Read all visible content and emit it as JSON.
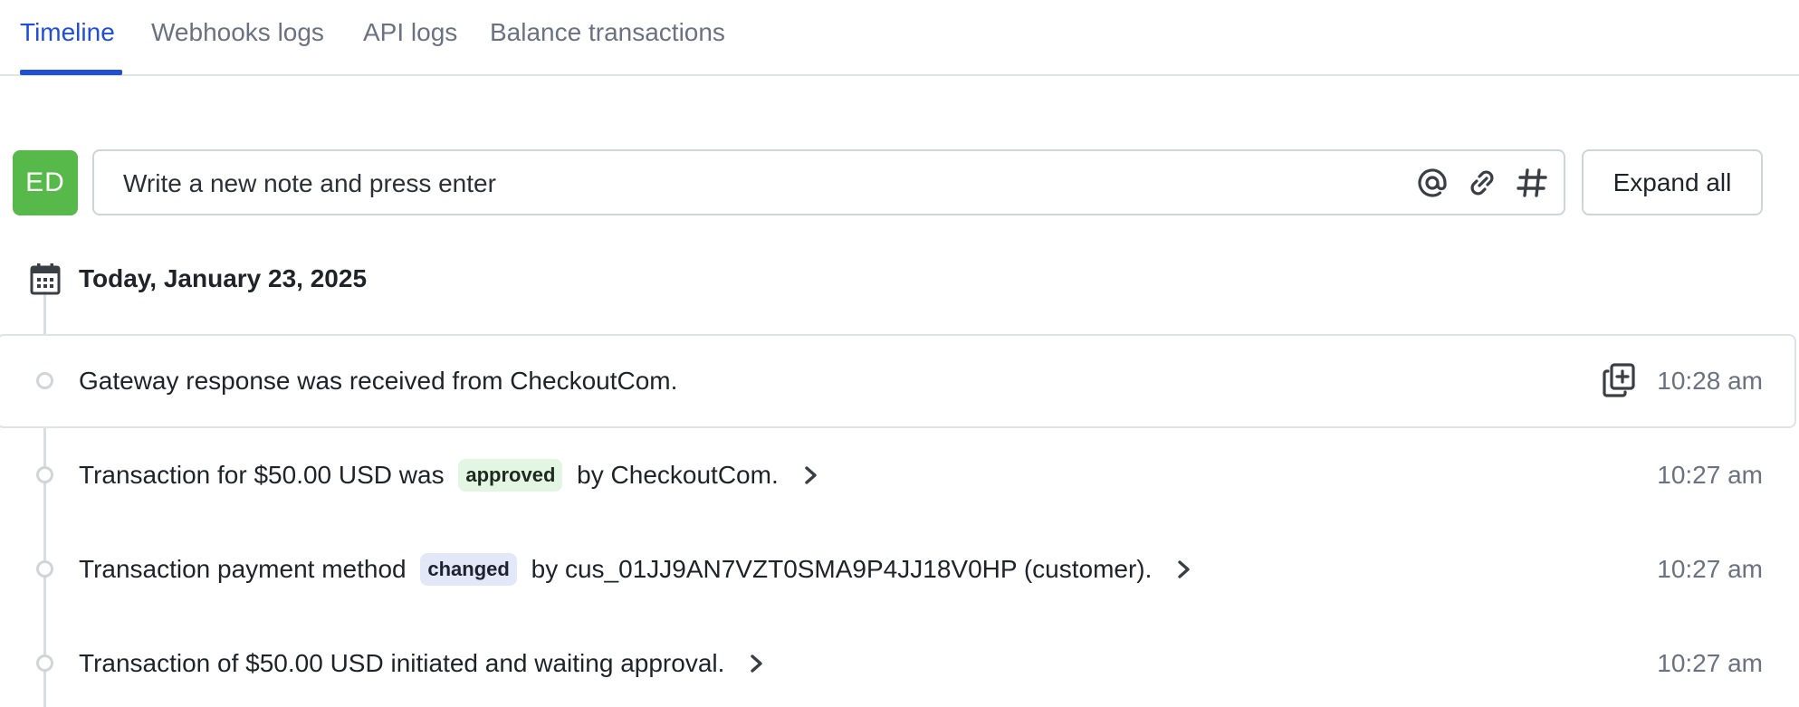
{
  "tabs": [
    {
      "label": "Timeline",
      "active": true
    },
    {
      "label": "Webhooks logs",
      "active": false
    },
    {
      "label": "API logs",
      "active": false
    },
    {
      "label": "Balance transactions",
      "active": false
    }
  ],
  "composer": {
    "avatar_initials": "ED",
    "placeholder": "Write a new note and press enter",
    "icons": [
      "at-sign-icon",
      "paperclip-icon",
      "hashtag-icon"
    ],
    "expand_all_label": "Expand all"
  },
  "timeline": {
    "date_heading": "Today, January 23, 2025",
    "events": [
      {
        "text_before": "Gateway response was received from CheckoutCom.",
        "badge": "",
        "text_after": "",
        "time": "10:28 am",
        "has_copy_icon": true,
        "has_chevron": false
      },
      {
        "text_before": "Transaction for $50.00 USD was ",
        "badge": "approved",
        "text_after": " by CheckoutCom.",
        "time": "10:27 am",
        "has_copy_icon": false,
        "has_chevron": true
      },
      {
        "text_before": "Transaction payment method ",
        "badge": "changed",
        "text_after": " by cus_01JJ9AN7VZT0SMA9P4JJ18V0HP (customer).",
        "time": "10:27 am",
        "has_copy_icon": false,
        "has_chevron": true
      },
      {
        "text_before": "Transaction of $50.00 USD initiated and waiting approval.",
        "badge": "",
        "text_after": "",
        "time": "10:27 am",
        "has_copy_icon": false,
        "has_chevron": true
      }
    ]
  },
  "colors": {
    "accent": "#1f4fd8",
    "avatar_bg": "#57b94a",
    "approved_badge_bg": "#e2f6e3",
    "changed_badge_bg": "#e3e8f8",
    "muted_text": "#6a7180"
  }
}
